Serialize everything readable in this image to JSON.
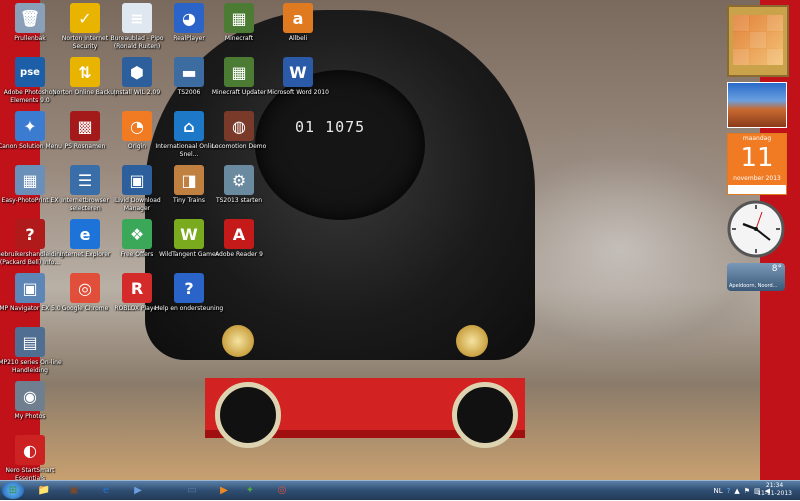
{
  "desktop_icons": [
    {
      "label": "Prullenbak",
      "icon": "recycle-bin-icon",
      "glyph": "🗑",
      "color": "#8aa0b8"
    },
    {
      "label": "Adobe Photoshop Elements 9.0",
      "icon": "photoshop-icon",
      "glyph": "pse",
      "color": "#1c5fa8"
    },
    {
      "label": "Canon Solution Menu",
      "icon": "canon-icon",
      "glyph": "✦",
      "color": "#3b7bd0"
    },
    {
      "label": "Easy-PhotoPrint EX",
      "icon": "photoprint-icon",
      "glyph": "▦",
      "color": "#6a8fb8"
    },
    {
      "label": "Gebruikershandleiding (Packard Bell) Info...",
      "icon": "help-icon",
      "glyph": "?",
      "color": "#b11a1a"
    },
    {
      "label": "MP Navigator EX 5.0",
      "icon": "mp-navigator-icon",
      "glyph": "▣",
      "color": "#5d86b6"
    },
    {
      "label": "MP210 series On-line Handleiding",
      "icon": "manual-icon",
      "glyph": "▤",
      "color": "#4f6e92"
    },
    {
      "label": "My Photos",
      "icon": "my-photos-icon",
      "glyph": "◉",
      "color": "#6f7f8f"
    },
    {
      "label": "Nero StartSmart Essentials",
      "icon": "nero-icon",
      "glyph": "◐",
      "color": "#c22"
    },
    {
      "label": "Norton Internet Security",
      "icon": "norton-icon",
      "glyph": "✓",
      "color": "#e8b400"
    },
    {
      "label": "Norton Online Backup",
      "icon": "norton-backup-icon",
      "glyph": "⇅",
      "color": "#e8b400"
    },
    {
      "label": "PS Rosnamen",
      "icon": "ps-icon",
      "glyph": "▩",
      "color": "#a41a1a"
    },
    {
      "label": "Internetbrowser selecteren",
      "icon": "browser-select-icon",
      "glyph": "☰",
      "color": "#3a6ea8"
    },
    {
      "label": "Internet Explorer",
      "icon": "ie-icon",
      "glyph": "e",
      "color": "#1e73d8"
    },
    {
      "label": "Google Chrome",
      "icon": "chrome-icon",
      "glyph": "◎",
      "color": "#e14f3a"
    },
    {
      "label": "Bureaublad - Pipo (Ronald Ruiten)",
      "icon": "document-icon",
      "glyph": "≡",
      "color": "#dfe7f0"
    },
    {
      "label": "Install WIL 2.09",
      "icon": "install-icon",
      "glyph": "⬢",
      "color": "#2c5f9c"
    },
    {
      "label": "Origin",
      "icon": "origin-icon",
      "glyph": "◔",
      "color": "#f07b23"
    },
    {
      "label": "iLivid Download Manager",
      "icon": "download-manager-icon",
      "glyph": "▣",
      "color": "#2c5f9c"
    },
    {
      "label": "Free Offers",
      "icon": "gift-icon",
      "glyph": "❖",
      "color": "#3aa858"
    },
    {
      "label": "ROBLOX Player",
      "icon": "roblox-icon",
      "glyph": "R",
      "color": "#d42a2a"
    },
    {
      "label": "RealPlayer",
      "icon": "realplayer-icon",
      "glyph": "◕",
      "color": "#2a64c8"
    },
    {
      "label": "TS2006",
      "icon": "ts2006-icon",
      "glyph": "▬",
      "color": "#3c6ca0"
    },
    {
      "label": "Internationaal Online - Snel...",
      "icon": "internationaal-icon",
      "glyph": "⌂",
      "color": "#1e78c8"
    },
    {
      "label": "Tiny Trains",
      "icon": "tiny-trains-icon",
      "glyph": "◨",
      "color": "#c08040"
    },
    {
      "label": "WildTangent Games",
      "icon": "wildtangent-icon",
      "glyph": "W",
      "color": "#7aaa1e"
    },
    {
      "label": "Help en ondersteuning",
      "icon": "help-support-icon",
      "glyph": "?",
      "color": "#2a64c8"
    },
    {
      "label": "Minecraft",
      "icon": "minecraft-icon",
      "glyph": "▦",
      "color": "#4c7c34"
    },
    {
      "label": "Minecraft Updater",
      "icon": "minecraft-updater-icon",
      "glyph": "▦",
      "color": "#4c7c34"
    },
    {
      "label": "Locomotion Demo",
      "icon": "locomotion-icon",
      "glyph": "◍",
      "color": "#7a3a2a"
    },
    {
      "label": "TS2013 starten",
      "icon": "ts2013-icon",
      "glyph": "⚙",
      "color": "#6a8aa0"
    },
    {
      "label": "Adobe Reader 9",
      "icon": "adobe-reader-icon",
      "glyph": "A",
      "color": "#c41a1a"
    },
    {
      "label": "Allbeli",
      "icon": "allbeli-icon",
      "glyph": "a",
      "color": "#e07a20"
    },
    {
      "label": "Microsoft Word 2010",
      "icon": "word-icon",
      "glyph": "W",
      "color": "#2a5aa8"
    }
  ],
  "train": {
    "number": "01 1075"
  },
  "gadgets": {
    "calendar": {
      "day_name": "maandag",
      "day": "11",
      "month_year": "november 2013"
    },
    "weather": {
      "temp": "8°",
      "location": "Apeldoorn, Noord..."
    }
  },
  "taskbar": {
    "pinned": [
      {
        "name": "start-button",
        "glyph": "⊞",
        "color": "#2f8a3a"
      },
      {
        "name": "explorer-taskbar-button",
        "glyph": "📁",
        "color": "#e0b040"
      },
      {
        "name": "calendar-taskbar-button",
        "glyph": "▣",
        "color": "#7a4a2a"
      },
      {
        "name": "ie-taskbar-button",
        "glyph": "e",
        "color": "#1e73d8"
      },
      {
        "name": "media-player-taskbar-button",
        "glyph": "▶",
        "color": "#6a9ee0"
      },
      {
        "name": "window-taskbar-button",
        "glyph": "▭",
        "color": "#5a7aa8"
      },
      {
        "name": "media-center-taskbar-button",
        "glyph": "▶",
        "color": "#f08a20"
      },
      {
        "name": "network-taskbar-button",
        "glyph": "✦",
        "color": "#4aa840"
      },
      {
        "name": "chrome-taskbar-button",
        "glyph": "◎",
        "color": "#e14f3a"
      }
    ],
    "tray": {
      "language": "NL"
    },
    "clock": {
      "time": "21:34",
      "date": "11-11-2013"
    }
  }
}
